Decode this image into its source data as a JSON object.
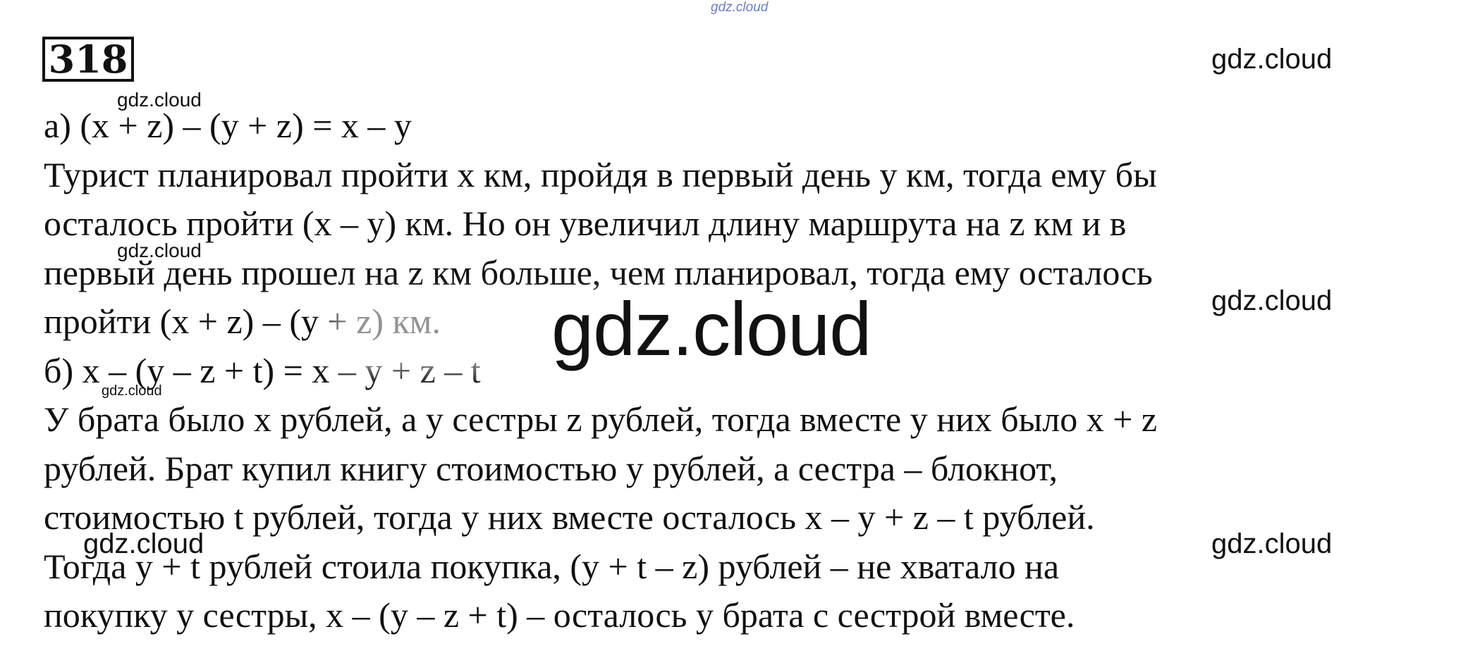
{
  "header": {
    "top_watermark": "gdz.cloud",
    "problem_number": "318"
  },
  "content": {
    "lines": [
      "а) (x + z) – (y + z) = x – y",
      "Турист планировал пройти x км, пройдя в первый день y км, тогда ему бы",
      "осталось пройти (x – y) км. Но он увеличил длину маршрута на z км и в",
      "первый день прошел на z км больше, чем планировал, тогда ему осталось",
      "пройти (x + z) – (y + z) км.",
      "б) x – (y – z + t) = x – y + z – t",
      "У брата было x рублей, а у сестры z рублей, тогда вместе у них было x + z",
      "рублей. Брат купил книгу стоимостью y рублей, а сестра – блокнот,",
      "стоимостью t рублей, тогда у них вместе осталось x – y + z – t рублей.",
      "Тогда y + t рублей стоила покупка, (y + t – z) рублей – не хватало на",
      "покупку у сестры, x – (y – z + t) – осталось у брата с сестрой вместе."
    ]
  },
  "watermarks": {
    "center": "gdz.cloud",
    "marks": [
      "gdz.cloud",
      "gdz.cloud",
      "gdz.cloud",
      "gdz.cloud",
      "gdz.cloud",
      "gdz.cloud",
      "gdz.cloud"
    ]
  }
}
